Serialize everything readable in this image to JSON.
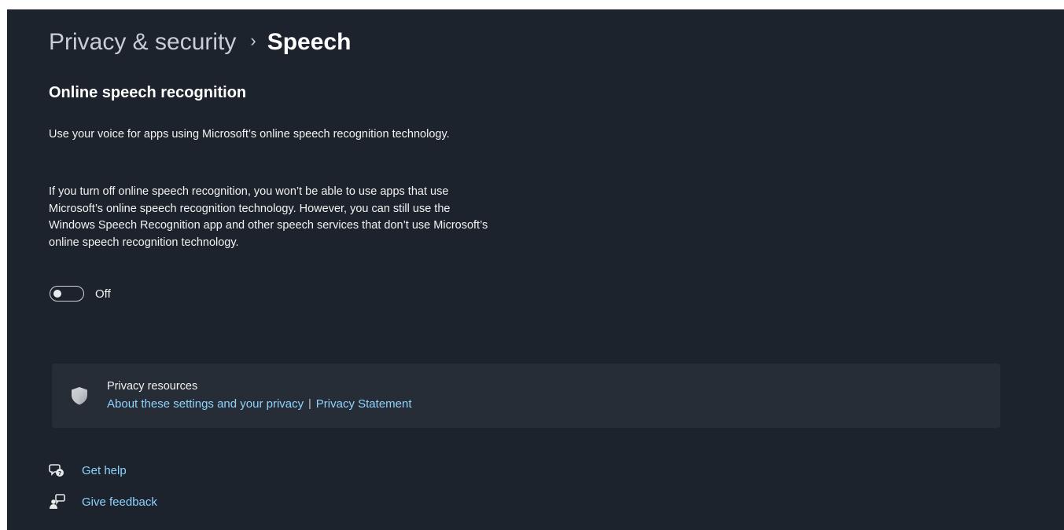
{
  "breadcrumb": {
    "parent": "Privacy & security",
    "separator": "›",
    "current": "Speech"
  },
  "section": {
    "title": "Online speech recognition",
    "description_1": "Use your voice for apps using Microsoft’s online speech recognition technology.",
    "description_2": "If you turn off online speech recognition, you won’t be able to use apps that use Microsoft’s online speech recognition technology.  However, you can still use the Windows Speech Recognition app and other speech services that don’t use Microsoft’s online speech recognition technology.",
    "toggle_state": "Off"
  },
  "privacy_resources": {
    "icon": "shield-icon",
    "title": "Privacy resources",
    "link_1": "About these settings and your privacy",
    "separator": "|",
    "link_2": "Privacy Statement"
  },
  "help": {
    "get_help_icon": "get-help-icon",
    "get_help_label": "Get help",
    "feedback_icon": "feedback-icon",
    "feedback_label": "Give feedback"
  },
  "colors": {
    "background": "#1c232c",
    "card": "#262d36",
    "link": "#8fd3ff",
    "text": "#ffffff"
  }
}
